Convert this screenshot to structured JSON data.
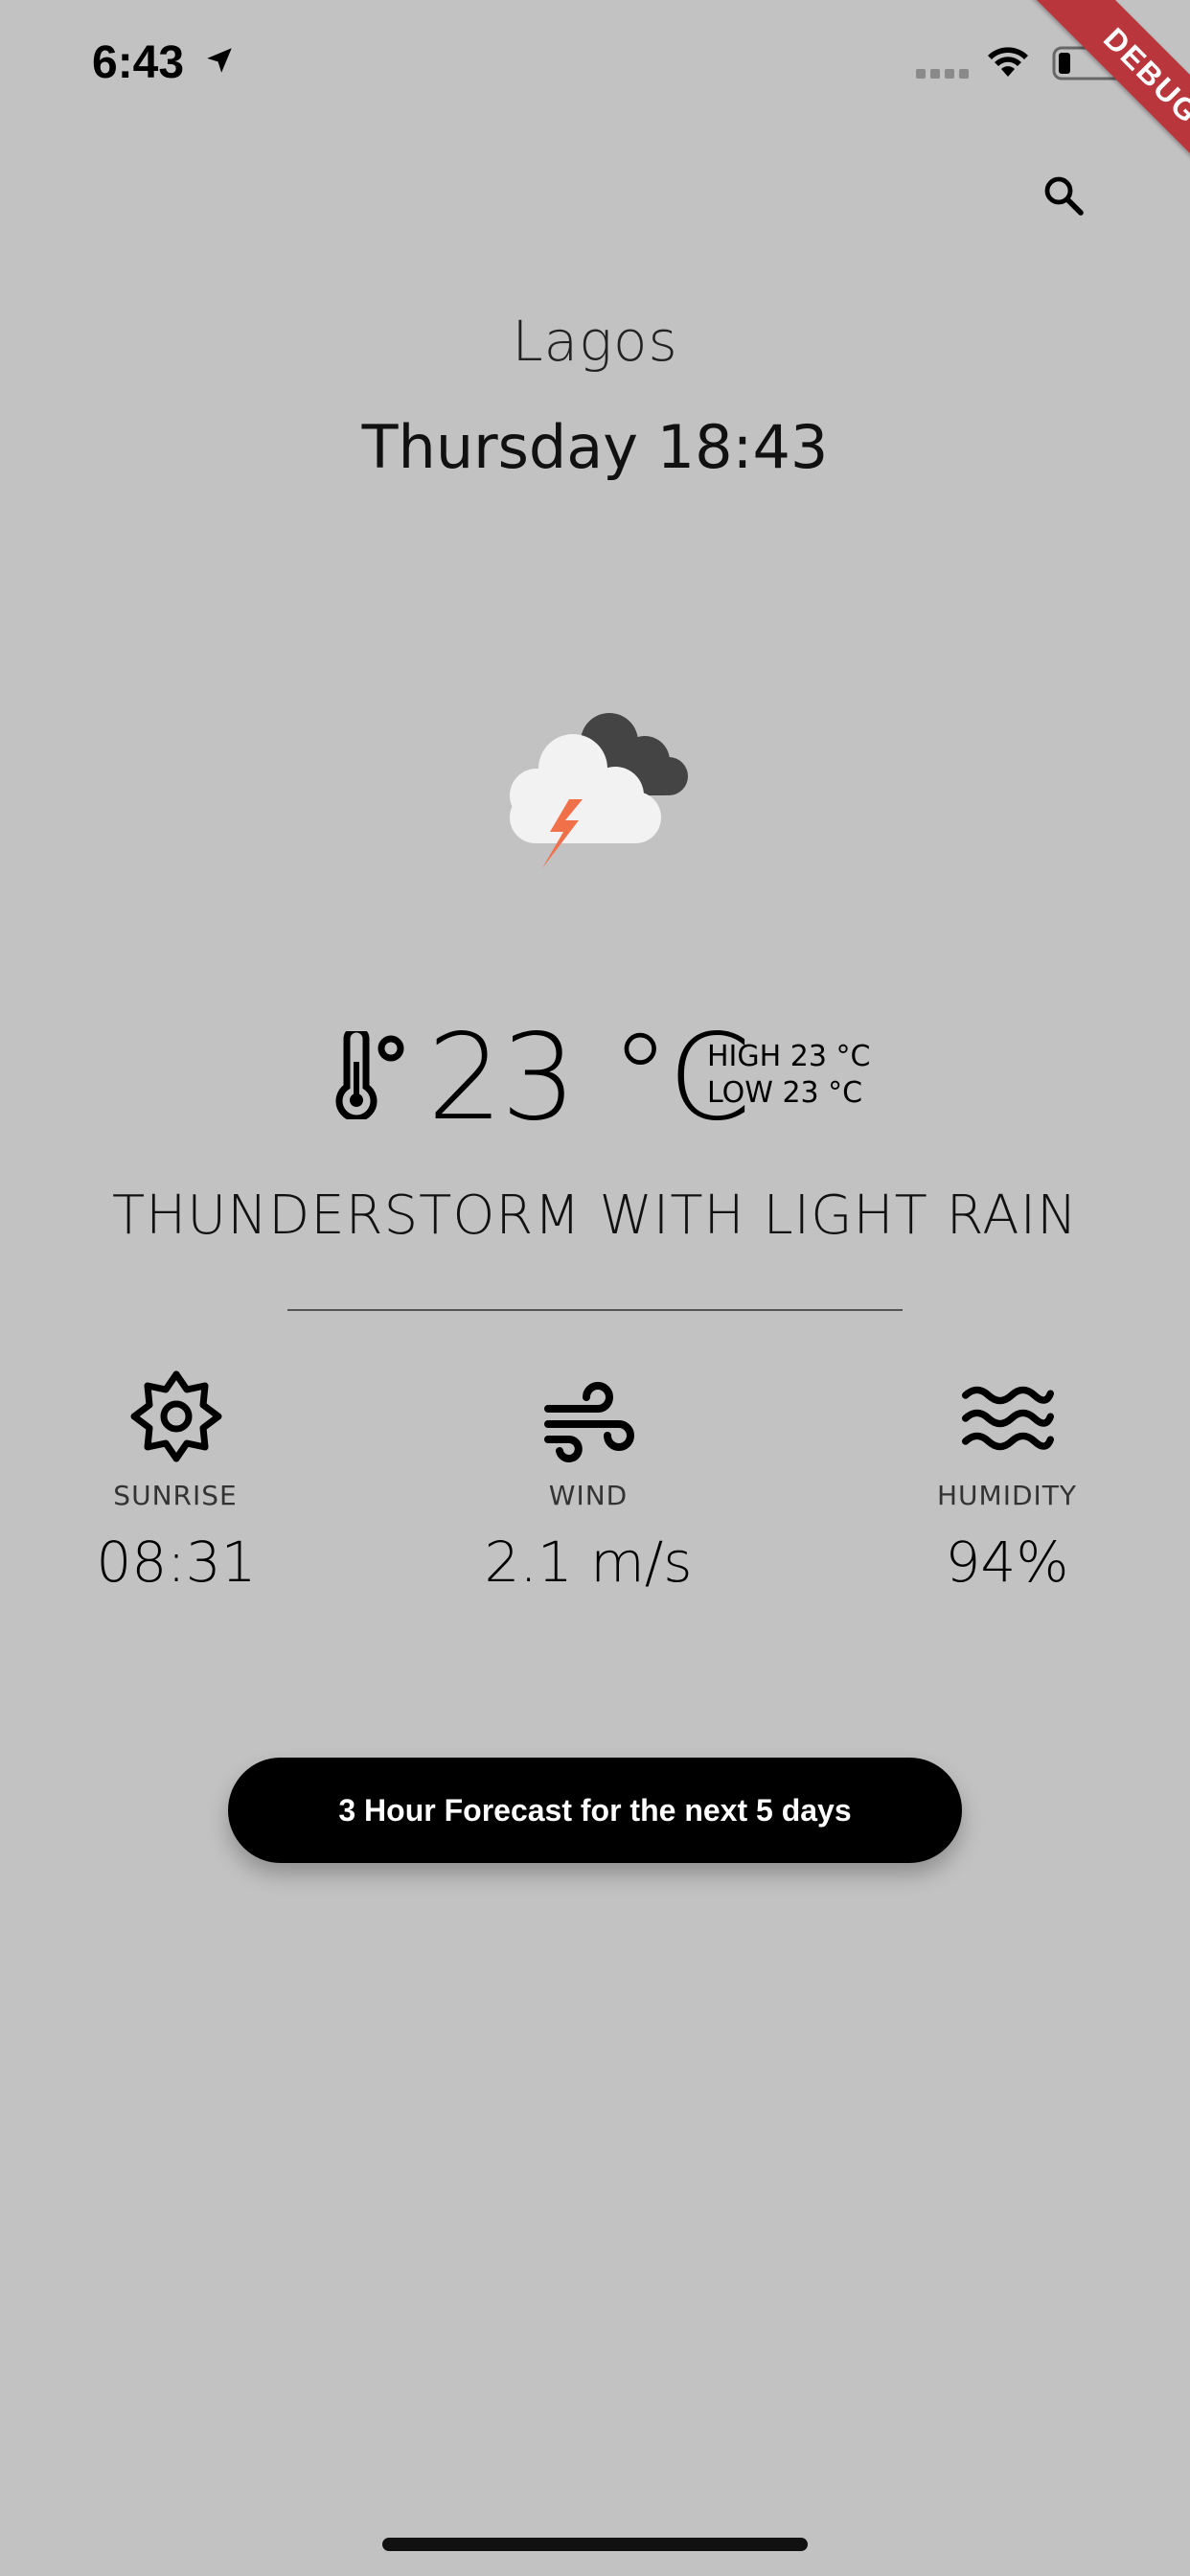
{
  "status_bar": {
    "time": "6:43"
  },
  "debug_banner": "DEBUG",
  "header": {
    "city": "Lagos",
    "datetime": "Thursday 18:43"
  },
  "current": {
    "temperature": "23 °C",
    "high": "HIGH 23 °C",
    "low": "LOW 23 °C",
    "description": "THUNDERSTORM WITH LIGHT RAIN"
  },
  "stats": {
    "sunrise": {
      "label": "SUNRISE",
      "value": "08:31"
    },
    "wind": {
      "label": "WIND",
      "value": "2.1 m/s"
    },
    "humidity": {
      "label": "HUMIDITY",
      "value": "94%"
    }
  },
  "forecast_button": {
    "label": "3 Hour Forecast for the next 5 days"
  },
  "colors": {
    "background": "#c2c2c2",
    "button_bg": "#000000",
    "lightning": "#f0704a",
    "debug_ribbon": "#b8363c"
  },
  "icons": {
    "weather": "thunderstorm-cloud-icon",
    "thermometer": "thermometer-icon",
    "sunrise": "sun-gear-icon",
    "wind": "wind-icon",
    "humidity": "waves-icon",
    "search": "search-icon"
  }
}
